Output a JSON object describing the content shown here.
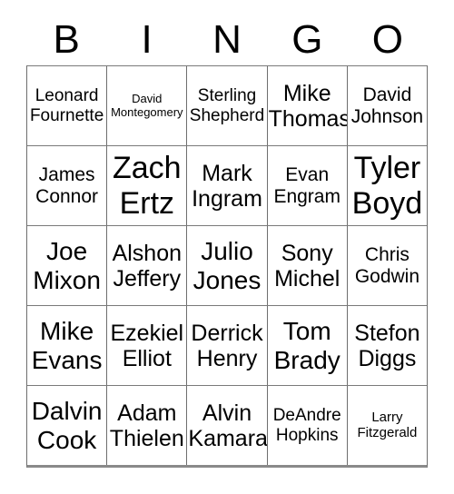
{
  "card": {
    "title_letters": [
      "B",
      "I",
      "N",
      "G",
      "O"
    ],
    "rows": [
      [
        {
          "name": "Leonard Fournette",
          "size": "fs-m"
        },
        {
          "name": "David Montegomery",
          "size": "fs-xs"
        },
        {
          "name": "Sterling Shepherd",
          "size": "fs-m"
        },
        {
          "name": "Mike Thomas",
          "size": "fs-l"
        },
        {
          "name": "David Johnson",
          "size": "fs-ml"
        }
      ],
      [
        {
          "name": "James Connor",
          "size": "fs-ml"
        },
        {
          "name": "Zach Ertz",
          "size": "fs-xxl"
        },
        {
          "name": "Mark Ingram",
          "size": "fs-l"
        },
        {
          "name": "Evan Engram",
          "size": "fs-ml"
        },
        {
          "name": "Tyler Boyd",
          "size": "fs-xxl"
        }
      ],
      [
        {
          "name": "Joe Mixon",
          "size": "fs-xl"
        },
        {
          "name": "Alshon Jeffery",
          "size": "fs-l"
        },
        {
          "name": "Julio Jones",
          "size": "fs-xl"
        },
        {
          "name": "Sony Michel",
          "size": "fs-l"
        },
        {
          "name": "Chris Godwin",
          "size": "fs-ml"
        }
      ],
      [
        {
          "name": "Mike Evans",
          "size": "fs-xl"
        },
        {
          "name": "Ezekiel Elliot",
          "size": "fs-l"
        },
        {
          "name": "Derrick Henry",
          "size": "fs-l"
        },
        {
          "name": "Tom Brady",
          "size": "fs-xl"
        },
        {
          "name": "Stefon Diggs",
          "size": "fs-l"
        }
      ],
      [
        {
          "name": "Dalvin Cook",
          "size": "fs-xl"
        },
        {
          "name": "Adam Thielen",
          "size": "fs-l"
        },
        {
          "name": "Alvin Kamara",
          "size": "fs-l"
        },
        {
          "name": "DeAndre Hopkins",
          "size": "fs-m"
        },
        {
          "name": "Larry Fitzgerald",
          "size": "fs-s"
        }
      ]
    ],
    "colors": {
      "background": "#ffffff",
      "text": "#000000",
      "grid_line": "#6e6e6e",
      "grid_bottom": "#8a8a8a"
    }
  }
}
